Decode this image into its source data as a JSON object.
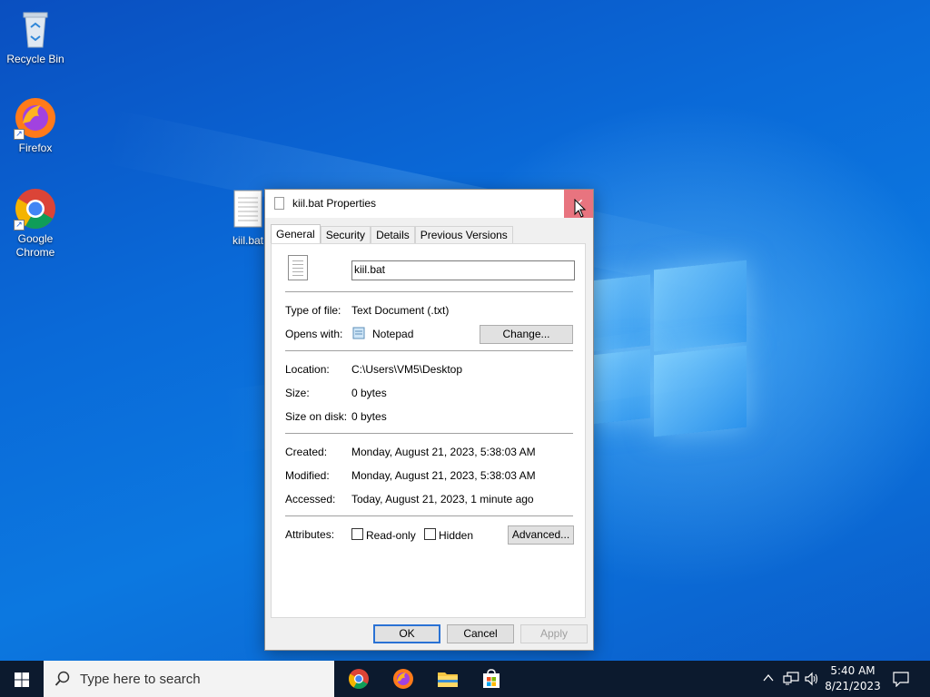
{
  "desktop": {
    "icons": [
      {
        "label": "Recycle Bin"
      },
      {
        "label": "Firefox"
      },
      {
        "label": "Google Chrome"
      },
      {
        "label": "kiil.bat"
      }
    ]
  },
  "dialog": {
    "title": "kiil.bat Properties",
    "close": "✕",
    "tabs": [
      {
        "label": "General",
        "active": true
      },
      {
        "label": "Security"
      },
      {
        "label": "Details"
      },
      {
        "label": "Previous Versions"
      }
    ],
    "file_name": "kiil.bat",
    "type_label": "Type of file:",
    "type_value": "Text Document (.txt)",
    "opens_label": "Opens with:",
    "opens_value": "Notepad",
    "change_button": "Change...",
    "location_label": "Location:",
    "location_value": "C:\\Users\\VM5\\Desktop",
    "size_label": "Size:",
    "size_value": "0 bytes",
    "size_on_disk_label": "Size on disk:",
    "size_on_disk_value": "0 bytes",
    "created_label": "Created:",
    "created_value": "Monday, August 21, 2023, 5:38:03 AM",
    "modified_label": "Modified:",
    "modified_value": "Monday, August 21, 2023, 5:38:03 AM",
    "accessed_label": "Accessed:",
    "accessed_value": "Today, August 21, 2023, 1 minute ago",
    "attributes_label": "Attributes:",
    "readonly_label": "Read-only",
    "readonly_checked": false,
    "hidden_label": "Hidden",
    "hidden_checked": false,
    "advanced_button": "Advanced...",
    "ok_button": "OK",
    "cancel_button": "Cancel",
    "apply_button": "Apply"
  },
  "taskbar": {
    "search_placeholder": "Type here to search",
    "pinned": [
      "chrome-icon",
      "firefox-icon",
      "file-explorer-icon",
      "store-icon"
    ],
    "clock_time": "5:40 AM",
    "clock_date": "8/21/2023"
  },
  "colors": {
    "close_hover": "#e8747f",
    "ok_border": "#2a72d4",
    "taskbar": "#0c1a2e"
  }
}
